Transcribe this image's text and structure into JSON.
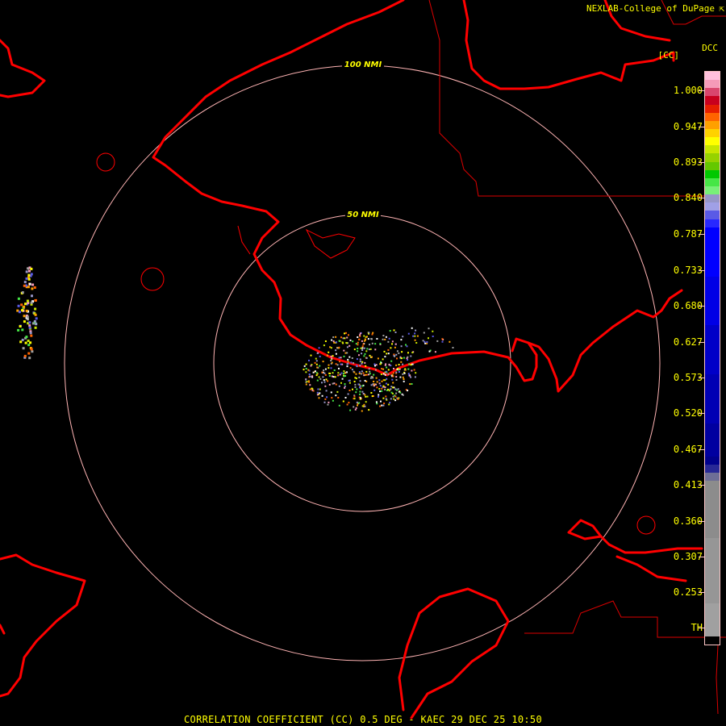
{
  "header": {
    "credit": "NEXLAB-College of DuPage",
    "credit_icon": "external-link-icon",
    "product_code": "DCC",
    "product_unit": "[CC]"
  },
  "range_rings": [
    {
      "label": "50 NMI"
    },
    {
      "label": "100 NMI"
    }
  ],
  "legend": {
    "ticks": [
      "1.000",
      "0.947",
      "0.893",
      "0.840",
      "0.787",
      "0.733",
      "0.680",
      "0.627",
      "0.573",
      "0.520",
      "0.467",
      "0.413",
      "0.360",
      "0.307",
      "0.253",
      "TH"
    ],
    "colors": [
      "#ffc0dc",
      "#f59ab8",
      "#d9466e",
      "#c8001e",
      "#e61e00",
      "#ff6400",
      "#ffa000",
      "#ffd200",
      "#ffff00",
      "#c8e600",
      "#96d200",
      "#64c800",
      "#00c800",
      "#46e646",
      "#78f078",
      "#9696c8",
      "#a0a0e6",
      "#5a5ae6",
      "#2828ff",
      "#0000ff",
      "#0000e6",
      "#0000c8",
      "#0000b4",
      "#0000a0",
      "#00008c",
      "#282896",
      "#6e6e96",
      "#8c8c8c",
      "#969696",
      "#a0a0a0",
      "#000000"
    ],
    "color_weights": [
      1,
      1,
      1,
      1,
      1,
      1,
      1,
      1,
      1,
      1,
      1,
      1,
      1,
      1,
      1,
      1,
      1,
      1,
      1,
      6,
      6,
      6,
      6,
      4,
      1,
      1,
      1,
      7,
      8,
      4,
      1
    ]
  },
  "colors": {
    "coastline": "#ff0000",
    "boundary": "#dc0000",
    "range_ring": "#ffb4b4",
    "text": "#ffff00"
  },
  "footer": {
    "title": "CORRELATION COEFFICIENT (CC) 0.5 DEG - KAEC 29 DEC 25 10:50"
  }
}
